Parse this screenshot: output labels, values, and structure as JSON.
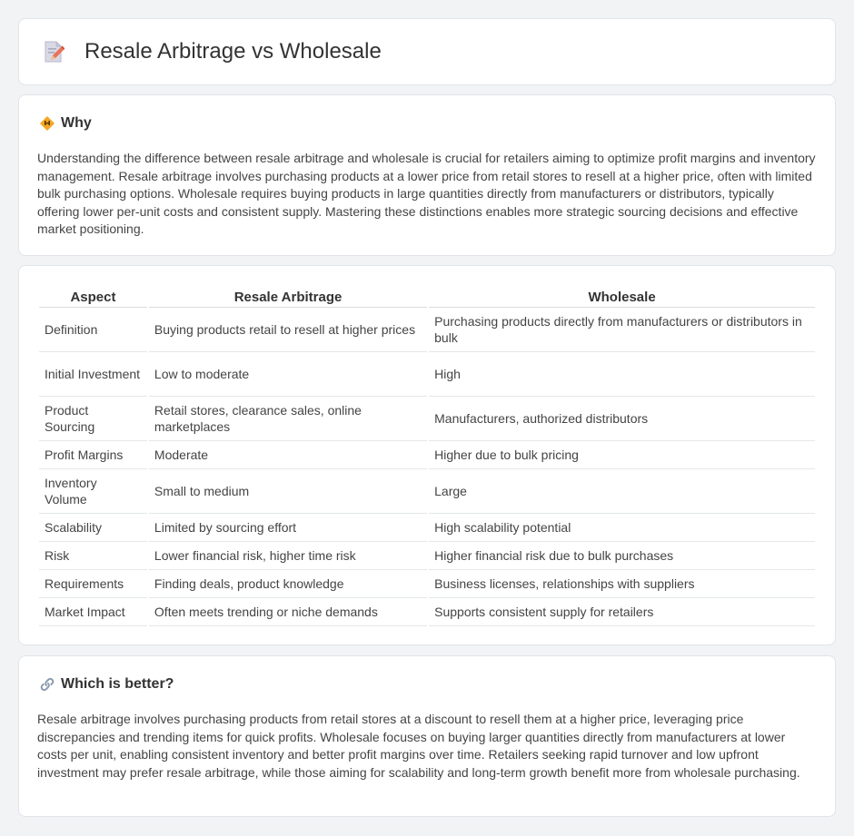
{
  "header": {
    "title": "Resale Arbitrage vs Wholesale",
    "icon": "document-pencil-icon"
  },
  "why": {
    "icon": "diamond-warning-icon",
    "title": "Why",
    "body": "Understanding the difference between resale arbitrage and wholesale is crucial for retailers aiming to optimize profit margins and inventory management. Resale arbitrage involves purchasing products at a lower price from retail stores to resell at a higher price, often with limited bulk purchasing options. Wholesale requires buying products in large quantities directly from manufacturers or distributors, typically offering lower per-unit costs and consistent supply. Mastering these distinctions enables more strategic sourcing decisions and effective market positioning."
  },
  "table": {
    "headers": [
      "Aspect",
      "Resale Arbitrage",
      "Wholesale"
    ],
    "rows": [
      [
        "Definition",
        "Buying products retail to resell at higher prices",
        "Purchasing products directly from manufacturers or distributors in bulk"
      ],
      [
        "Initial Investment",
        "Low to moderate",
        "High"
      ],
      [
        "Product Sourcing",
        "Retail stores, clearance sales, online marketplaces",
        "Manufacturers, authorized distributors"
      ],
      [
        "Profit Margins",
        "Moderate",
        "Higher due to bulk pricing"
      ],
      [
        "Inventory Volume",
        "Small to medium",
        "Large"
      ],
      [
        "Scalability",
        "Limited by sourcing effort",
        "High scalability potential"
      ],
      [
        "Risk",
        "Lower financial risk, higher time risk",
        "Higher financial risk due to bulk purchases"
      ],
      [
        "Requirements",
        "Finding deals, product knowledge",
        "Business licenses, relationships with suppliers"
      ],
      [
        "Market Impact",
        "Often meets trending or niche demands",
        "Supports consistent supply for retailers"
      ]
    ]
  },
  "better": {
    "icon": "link-icon",
    "title": "Which is better?",
    "body": "Resale arbitrage involves purchasing products from retail stores at a discount to resell them at a higher price, leveraging price discrepancies and trending items for quick profits. Wholesale focuses on buying larger quantities directly from manufacturers at lower costs per unit, enabling consistent inventory and better profit margins over time. Retailers seeking rapid turnover and low upfront investment may prefer resale arbitrage, while those aiming for scalability and long-term growth benefit more from wholesale purchasing."
  }
}
